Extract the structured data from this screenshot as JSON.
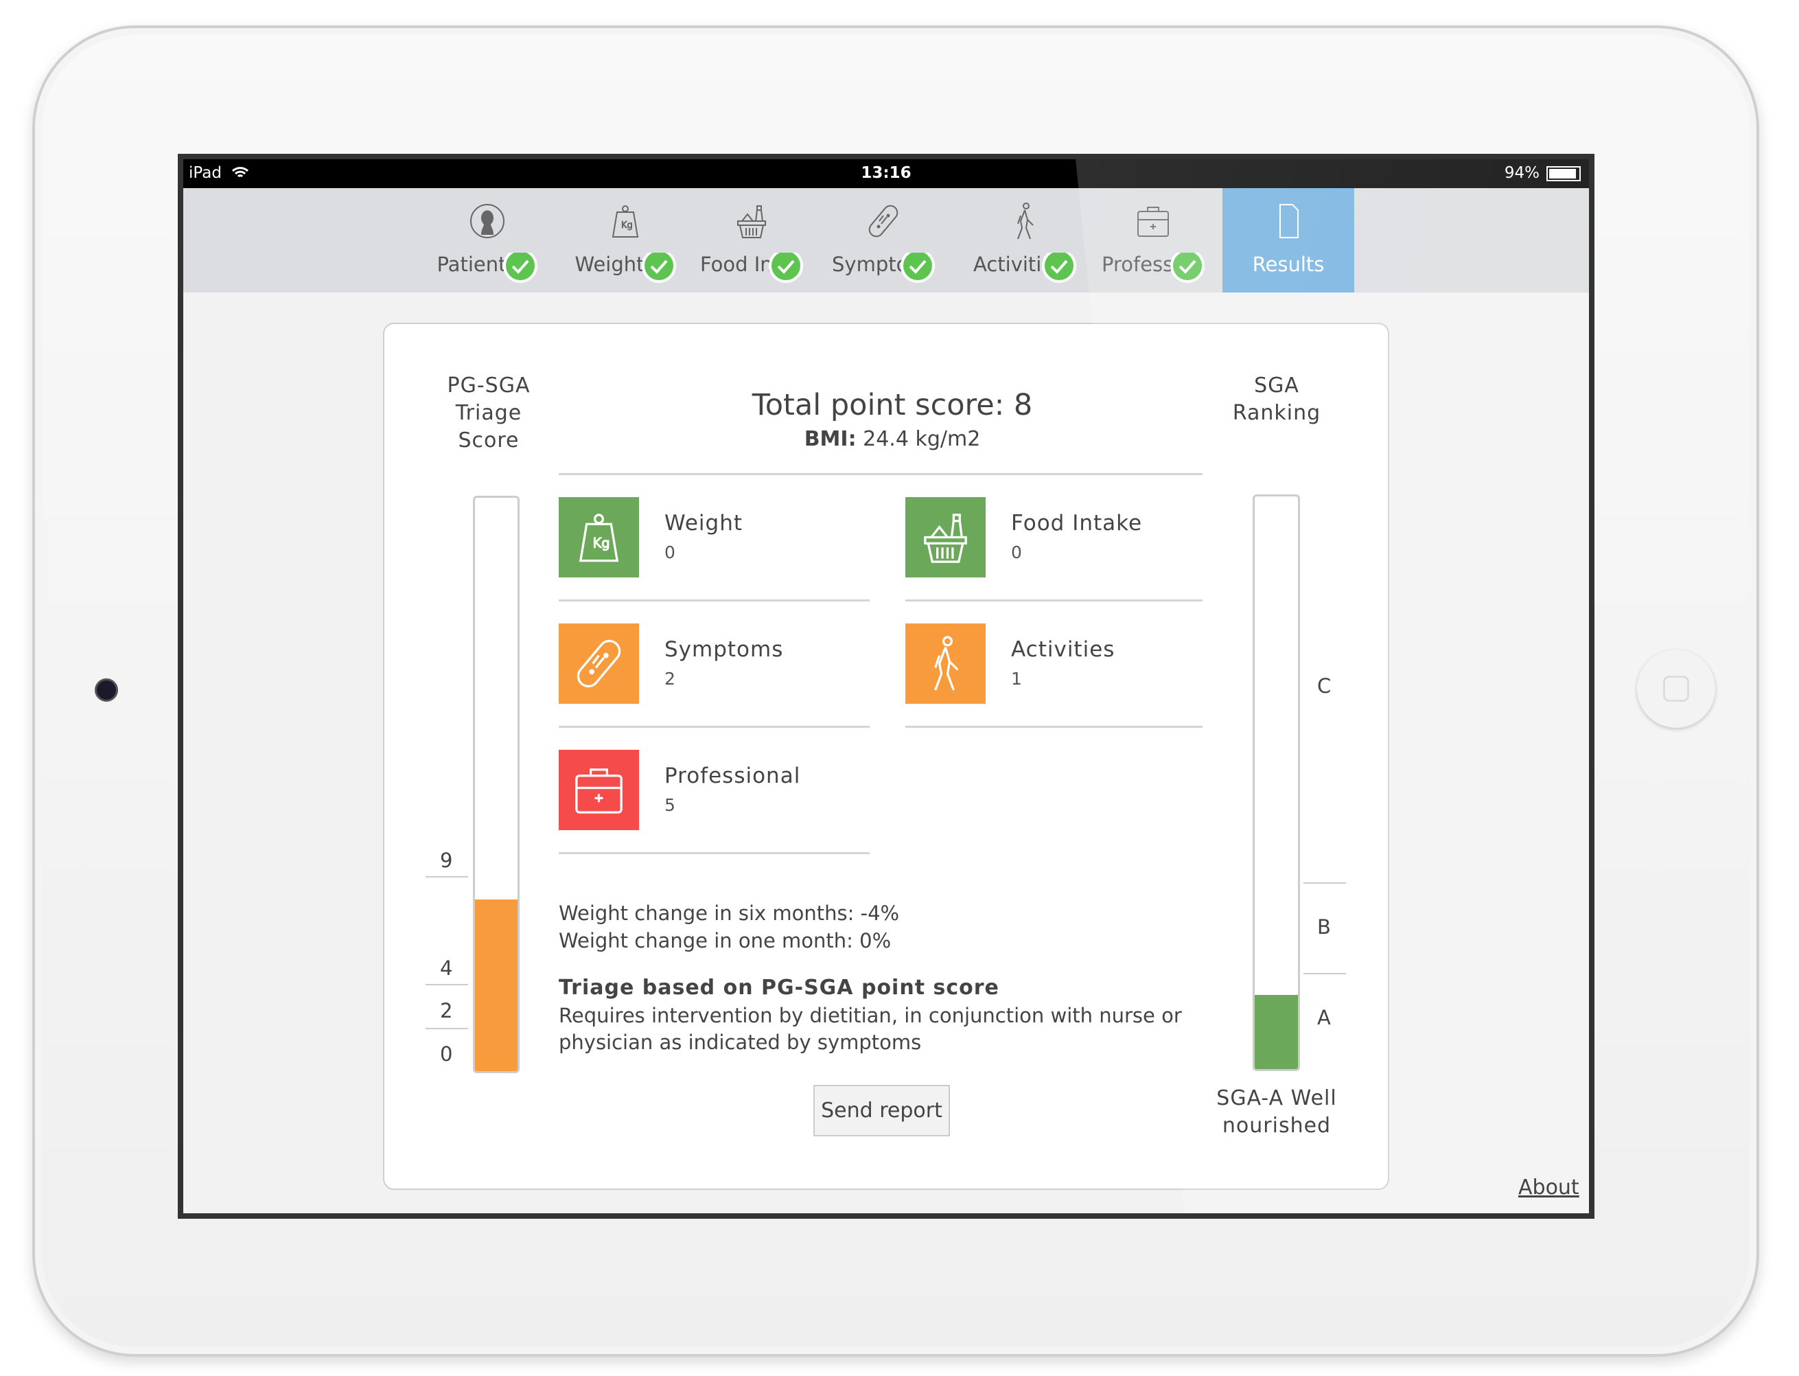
{
  "status_bar": {
    "device": "iPad",
    "time": "13:16",
    "battery": "94%"
  },
  "nav": {
    "tabs": [
      {
        "label": "Patient",
        "icon": "person-icon",
        "completed": true
      },
      {
        "label": "Weight",
        "icon": "weight-kg-icon",
        "completed": true
      },
      {
        "label": "Food Intake",
        "icon": "food-basket-icon",
        "completed": true
      },
      {
        "label": "Symptoms",
        "icon": "bandage-icon",
        "completed": true
      },
      {
        "label": "Activities",
        "icon": "walking-icon",
        "completed": true
      },
      {
        "label": "Professional",
        "icon": "medical-kit-icon",
        "completed": true
      },
      {
        "label": "Results",
        "icon": "document-icon",
        "active": true
      }
    ]
  },
  "left_panel": {
    "title_lines": [
      "PG-SGA",
      "Triage",
      "Score"
    ],
    "score": 8,
    "fill_percent": 30,
    "ticks": [
      "9",
      "4",
      "2",
      "0"
    ],
    "fill_color": "#f79b3c"
  },
  "summary": {
    "total": "Total point score: 8",
    "bmi_label": "BMI:",
    "bmi_value": "24.4 kg/m2"
  },
  "categories": [
    {
      "title": "Weight",
      "value": "0",
      "color": "#6ca85a",
      "icon": "weight-kg-icon"
    },
    {
      "title": "Food Intake",
      "value": "0",
      "color": "#6ca85a",
      "icon": "food-basket-icon"
    },
    {
      "title": "Symptoms",
      "value": "2",
      "color": "#f79b3c",
      "icon": "bandage-icon"
    },
    {
      "title": "Activities",
      "value": "1",
      "color": "#f79b3c",
      "icon": "walking-icon"
    },
    {
      "title": "Professional",
      "value": "5",
      "color": "#f54b4b",
      "icon": "medical-kit-icon"
    }
  ],
  "weight_change": [
    "Weight change in six months: -4%",
    "Weight change in one month: 0%"
  ],
  "triage": {
    "heading": "Triage based on PG-SGA point score",
    "body_lines": [
      "Requires intervention by dietitian, in conjunction with nurse or",
      "physician as indicated by symptoms"
    ]
  },
  "send_button": "Send report",
  "right_panel": {
    "title_lines": [
      "SGA",
      "Ranking"
    ],
    "levels": [
      "C",
      "B",
      "A"
    ],
    "fill_percent": 13,
    "fill_color": "#6ca85a",
    "result_lines": [
      "SGA-A Well",
      "nourished"
    ]
  },
  "about": "About"
}
